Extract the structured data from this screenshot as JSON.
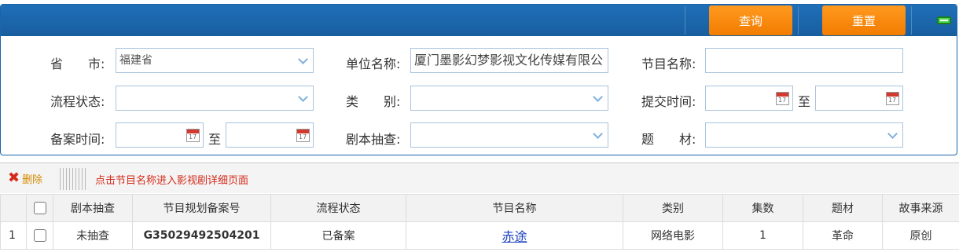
{
  "toolbar": {
    "query_label": "查询",
    "reset_label": "重置"
  },
  "form": {
    "province": {
      "label": "省　　市:",
      "value": "福建省"
    },
    "unit_name": {
      "label": "单位名称:",
      "value": "厦门墨影幻梦影视文化传媒有限公"
    },
    "program_name": {
      "label": "节目名称:",
      "value": ""
    },
    "process_status": {
      "label": "流程状态:",
      "value": ""
    },
    "category": {
      "label": "类　　别:",
      "value": ""
    },
    "submit_time": {
      "label": "提交时间:",
      "start": "",
      "end": "",
      "to": "至"
    },
    "record_time": {
      "label": "备案时间:",
      "start": "",
      "end": "",
      "to": "至"
    },
    "script_check": {
      "label": "剧本抽查:",
      "value": ""
    },
    "theme": {
      "label": "题　　材:",
      "value": ""
    },
    "calendar_day": "17"
  },
  "grid_toolbar": {
    "delete_label": "删除",
    "hint": "点击节目名称进入影视剧详细页面"
  },
  "table": {
    "columns": [
      "",
      "",
      "剧本抽查",
      "节目规划备案号",
      "流程状态",
      "节目名称",
      "类别",
      "集数",
      "题材",
      "故事来源"
    ],
    "rows": [
      {
        "num": "1",
        "script_check": "未抽查",
        "record_no": "G35029492504201",
        "status": "已备案",
        "name": "赤途",
        "category": "网络电影",
        "episodes": "1",
        "theme": "革命",
        "source": "原创"
      }
    ]
  },
  "colors": {
    "toolbar_blue": "#1f6fb8",
    "button_orange": "#f68a0f",
    "record_no_red": "#c8141e",
    "link_blue": "#1a3fbf"
  }
}
